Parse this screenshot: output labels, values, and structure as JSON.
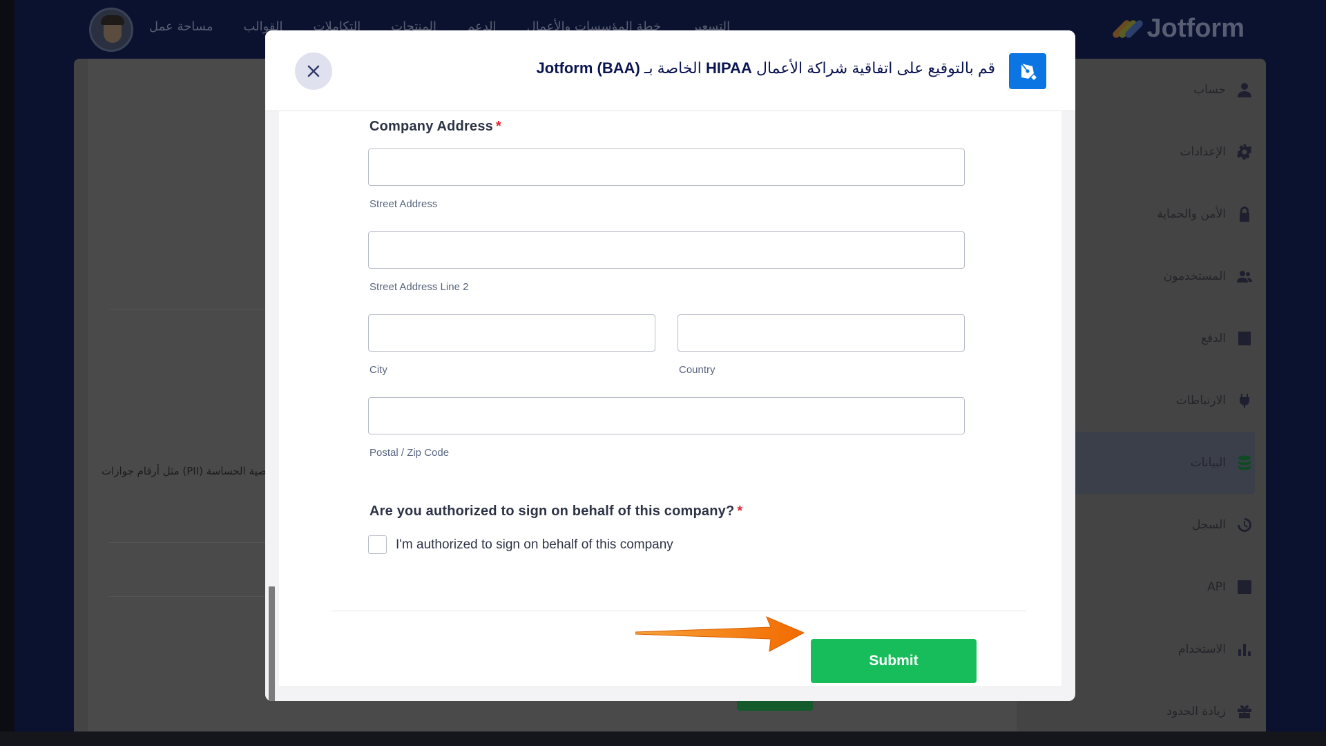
{
  "background_app": {
    "brand": "Jotform",
    "nav_items": [
      "التسعير",
      "خطة المؤسسات والأعمال",
      "الدعم",
      "المنتجات",
      "التكاملات",
      "القوالب",
      "مساحة عمل"
    ],
    "sidebar": [
      {
        "label": "حساب",
        "icon": "user-icon"
      },
      {
        "label": "الإعدادات",
        "icon": "gear-icon"
      },
      {
        "label": "الأمن والحماية",
        "icon": "lock-icon"
      },
      {
        "label": "المستخدمون",
        "icon": "users-icon"
      },
      {
        "label": "الدفع",
        "icon": "billing-icon"
      },
      {
        "label": "الارتباطات",
        "icon": "plug-icon"
      },
      {
        "label": "البيانات",
        "icon": "database-icon",
        "active": true
      },
      {
        "label": "السجل",
        "icon": "history-icon"
      },
      {
        "label": "API",
        "icon": "api-icon"
      },
      {
        "label": "الاستخدام",
        "icon": "bar-chart-icon"
      },
      {
        "label": "زيادة الحدود",
        "icon": "gift-icon"
      }
    ],
    "pii_text": "صية الحساسة (PII) مثل أرقام جوازات"
  },
  "modal": {
    "title_prefix": "قم بالتوقيع على اتفاقية شراكة الأعمال",
    "title_hipaa": "HIPAA",
    "title_middle": "الخاصة بـ",
    "title_brand": "Jotform (BAA)",
    "close_icon": "close-icon",
    "brand_icon": "jotform-sign-icon"
  },
  "form": {
    "address": {
      "label": "Company Address",
      "required_mark": "*",
      "street": {
        "value": "",
        "sublabel": "Street Address"
      },
      "street2": {
        "value": "",
        "sublabel": "Street Address Line 2"
      },
      "city": {
        "value": "",
        "sublabel": "City"
      },
      "country": {
        "value": "",
        "sublabel": "Country"
      },
      "postal": {
        "value": "",
        "sublabel": "Postal / Zip Code"
      }
    },
    "authorization": {
      "label": "Are you authorized to sign on behalf of this company?",
      "required_mark": "*",
      "checkbox_label": "I'm authorized to sign on behalf of this company",
      "checked": false
    },
    "submit_label": "Submit"
  },
  "colors": {
    "submit": "#18bd5b",
    "brand_blue": "#0a75e3",
    "title_navy": "#0a1551",
    "required_red": "#e0242f",
    "annotation_arrow": "#f57c00"
  }
}
